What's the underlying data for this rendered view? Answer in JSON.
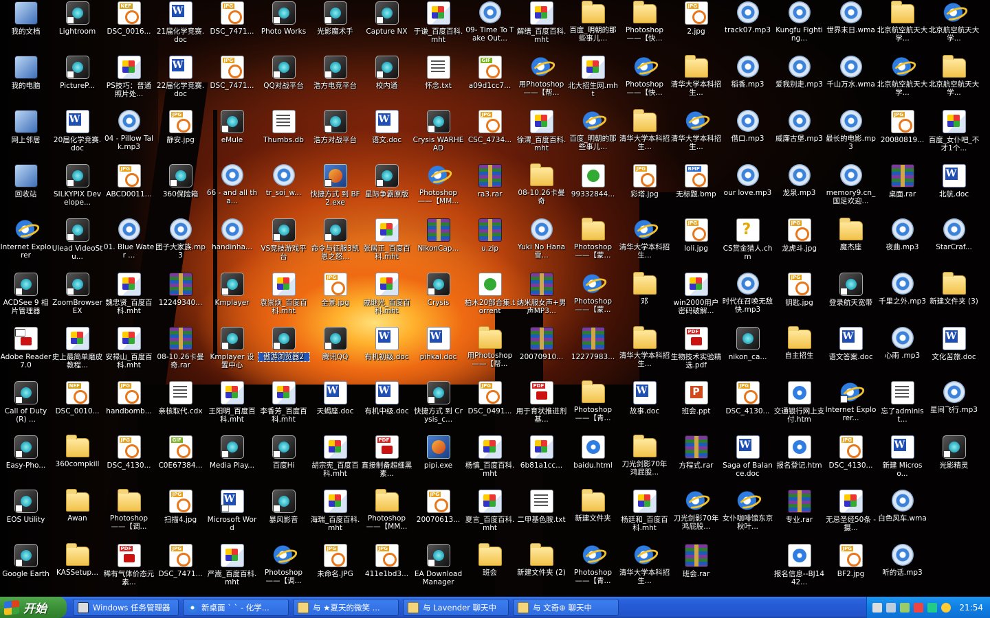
{
  "desktop": {
    "columns": [
      [
        {
          "label": "我的文档",
          "kind": "k-sys"
        },
        {
          "label": "我的电脑",
          "kind": "k-sys"
        },
        {
          "label": "网上邻居",
          "kind": "k-sys"
        },
        {
          "label": "回收站",
          "kind": "k-sys"
        },
        {
          "label": "Internet Explorer",
          "kind": "k-ie"
        },
        {
          "label": "ACDSee 9 相片管理器",
          "kind": "k-app",
          "shortcut": true
        },
        {
          "label": "Adobe Reader 7.0",
          "kind": "k-pdf",
          "shortcut": true
        },
        {
          "label": "Call of Duty(R) ...",
          "kind": "k-app",
          "shortcut": true
        },
        {
          "label": "Easy-Pho...",
          "kind": "k-app",
          "shortcut": true
        },
        {
          "label": "EOS Utility",
          "kind": "k-app",
          "shortcut": true
        },
        {
          "label": "Google Earth",
          "kind": "k-app",
          "shortcut": true
        }
      ],
      [
        {
          "label": "Lightroom",
          "kind": "k-app",
          "shortcut": true
        },
        {
          "label": "PictureP...",
          "kind": "k-app",
          "shortcut": true
        },
        {
          "label": "20届化学竞赛.doc",
          "kind": "k-doc"
        },
        {
          "label": "SILKYPIX Develope...",
          "kind": "k-app",
          "shortcut": true
        },
        {
          "label": "Ulead VideoStu...",
          "kind": "k-app",
          "shortcut": true
        },
        {
          "label": "ZoomBrowser EX",
          "kind": "k-app",
          "shortcut": true
        },
        {
          "label": "史上最简单磨皮教程...",
          "kind": "k-mht"
        },
        {
          "label": "DSC_0010...",
          "kind": "k-nef"
        },
        {
          "label": "360compkill",
          "kind": "k-folder"
        },
        {
          "label": "Awan",
          "kind": "k-folder"
        },
        {
          "label": "KASSetup...",
          "kind": "k-folder"
        }
      ],
      [
        {
          "label": "DSC_0016...",
          "kind": "k-nef"
        },
        {
          "label": "PS技巧：普通照片处...",
          "kind": "k-mht"
        },
        {
          "label": "04 - Pillow Talk.mp3",
          "kind": "k-mp3"
        },
        {
          "label": "ABCD0011...",
          "kind": "k-jpg"
        },
        {
          "label": "01. Blue Water ...",
          "kind": "k-mp3"
        },
        {
          "label": "魏忠贤_百度百科.mht",
          "kind": "k-mht"
        },
        {
          "label": "安禄山_百度百科.mht",
          "kind": "k-mht"
        },
        {
          "label": "handbomb...",
          "kind": "k-jpg"
        },
        {
          "label": "DSC_4130...",
          "kind": "k-jpg"
        },
        {
          "label": "Photoshop——【调...",
          "kind": "k-folder"
        },
        {
          "label": "稀有气体价态元素...",
          "kind": "k-pdf"
        }
      ],
      [
        {
          "label": "21届化学竞赛.doc",
          "kind": "k-doc"
        },
        {
          "label": "22届化学竞赛.doc",
          "kind": "k-doc"
        },
        {
          "label": "静安.jpg",
          "kind": "k-jpg"
        },
        {
          "label": "360保险箱",
          "kind": "k-app",
          "shortcut": true
        },
        {
          "label": "团子大家族.mp3",
          "kind": "k-mp3"
        },
        {
          "label": "12249340...",
          "kind": "k-rar"
        },
        {
          "label": "08-10.26卡曼奇.rar",
          "kind": "k-rar"
        },
        {
          "label": "亲核取代.cdx",
          "kind": "k-txt"
        },
        {
          "label": "C0E67384...",
          "kind": "k-gif"
        },
        {
          "label": "扫描4.jpg",
          "kind": "k-jpg"
        },
        {
          "label": "DSC_7471...",
          "kind": "k-jpg"
        }
      ],
      [
        {
          "label": "DSC_7471...",
          "kind": "k-jpg"
        },
        {
          "label": "DSC_7471...",
          "kind": "k-jpg"
        },
        {
          "label": "eMule",
          "kind": "k-app",
          "shortcut": true
        },
        {
          "label": "66 - and all tha...",
          "kind": "k-mp3"
        },
        {
          "label": "handinha...",
          "kind": "k-mp3"
        },
        {
          "label": "Kmplayer",
          "kind": "k-app",
          "shortcut": true
        },
        {
          "label": "Kmplayer 设置中心",
          "kind": "k-app",
          "shortcut": true
        },
        {
          "label": "王阳明_百度百科.mht",
          "kind": "k-mht"
        },
        {
          "label": "Media Play...",
          "kind": "k-app",
          "shortcut": true
        },
        {
          "label": "Microsoft Word",
          "kind": "k-doc",
          "shortcut": true
        },
        {
          "label": "严嵩_百度百科.mht",
          "kind": "k-mht"
        }
      ],
      [
        {
          "label": "Photo Works",
          "kind": "k-app",
          "shortcut": true
        },
        {
          "label": "QQ对战平台",
          "kind": "k-app",
          "shortcut": true
        },
        {
          "label": "Thumbs.db",
          "kind": "k-txt"
        },
        {
          "label": "tr_soi_w...",
          "kind": "k-mp3"
        },
        {
          "label": "VS竞技游戏平台",
          "kind": "k-app",
          "shortcut": true
        },
        {
          "label": "袁崇焕_百度百科.mht",
          "kind": "k-mht"
        },
        {
          "label": "傲游浏览器2",
          "kind": "k-app",
          "shortcut": true,
          "selected": true
        },
        {
          "label": "李香芳_百度百科.mht",
          "kind": "k-mht"
        },
        {
          "label": "百度Hi",
          "kind": "k-app",
          "shortcut": true
        },
        {
          "label": "暴风影音",
          "kind": "k-app",
          "shortcut": true
        },
        {
          "label": "Photoshop——【调...",
          "kind": "k-ie"
        }
      ],
      [
        {
          "label": "光影魔术手",
          "kind": "k-app",
          "shortcut": true
        },
        {
          "label": "浩方电竞平台",
          "kind": "k-app",
          "shortcut": true
        },
        {
          "label": "浩方对战平台",
          "kind": "k-app",
          "shortcut": true
        },
        {
          "label": "快捷方式 到 BF2.exe",
          "kind": "k-exe",
          "shortcut": true
        },
        {
          "label": "命令与征服3凯恩之怒...",
          "kind": "k-app",
          "shortcut": true
        },
        {
          "label": "全景.jpg",
          "kind": "k-jpg"
        },
        {
          "label": "腾讯QQ",
          "kind": "k-app",
          "shortcut": true
        },
        {
          "label": "天蝎座.doc",
          "kind": "k-doc"
        },
        {
          "label": "胡宗宪_百度百科.mht",
          "kind": "k-mht"
        },
        {
          "label": "海瑞_百度百科.mht",
          "kind": "k-mht"
        },
        {
          "label": "未命名.JPG",
          "kind": "k-jpg"
        }
      ],
      [
        {
          "label": "Capture NX",
          "kind": "k-app",
          "shortcut": true
        },
        {
          "label": "校内通",
          "kind": "k-app",
          "shortcut": true
        },
        {
          "label": "语文.doc",
          "kind": "k-doc"
        },
        {
          "label": "星际争霸原版",
          "kind": "k-app",
          "shortcut": true
        },
        {
          "label": "张居正_百度百科.mht",
          "kind": "k-mht"
        },
        {
          "label": "戚继光_百度百科.mht",
          "kind": "k-mht"
        },
        {
          "label": "有机初级.doc",
          "kind": "k-doc"
        },
        {
          "label": "有机中级.doc",
          "kind": "k-doc"
        },
        {
          "label": "直接制备超细黑素...",
          "kind": "k-pdf"
        },
        {
          "label": "Photoshop——【MM...",
          "kind": "k-folder"
        },
        {
          "label": "411e1bd3...",
          "kind": "k-jpg"
        }
      ],
      [
        {
          "label": "于谦_百度百科.mht",
          "kind": "k-mht"
        },
        {
          "label": "怀念.txt",
          "kind": "k-txt"
        },
        {
          "label": "Crysis WARHEAD",
          "kind": "k-app",
          "shortcut": true
        },
        {
          "label": "Photoshop——【MM...",
          "kind": "k-ie"
        },
        {
          "label": "NikonCap...",
          "kind": "k-rar"
        },
        {
          "label": "Crysis",
          "kind": "k-app",
          "shortcut": true
        },
        {
          "label": "pihkal.doc",
          "kind": "k-doc"
        },
        {
          "label": "快捷方式 到 Crysis_c...",
          "kind": "k-app",
          "shortcut": true
        },
        {
          "label": "pipi.exe",
          "kind": "k-exe"
        },
        {
          "label": "20070613...",
          "kind": "k-jpg"
        },
        {
          "label": "EA Download Manager",
          "kind": "k-app",
          "shortcut": true
        }
      ],
      [
        {
          "label": "09- Time To Take Out...",
          "kind": "k-mp3"
        },
        {
          "label": "a09d1cc7...",
          "kind": "k-gif"
        },
        {
          "label": "CSC_4734...",
          "kind": "k-jpg"
        },
        {
          "label": "ra3.rar",
          "kind": "k-rar"
        },
        {
          "label": "u.zip",
          "kind": "k-rar"
        },
        {
          "label": "柏木20部合集.torrent",
          "kind": "k-torrent"
        },
        {
          "label": "用Photoshop——【帮...",
          "kind": "k-folder"
        },
        {
          "label": "DSC_0491...",
          "kind": "k-jpg"
        },
        {
          "label": "杨慎_百度百科.mht",
          "kind": "k-mht"
        },
        {
          "label": "夏言_百度百科.mht",
          "kind": "k-mht"
        },
        {
          "label": "班会",
          "kind": "k-folder"
        }
      ],
      [
        {
          "label": "解缙_百度百科.mht",
          "kind": "k-mht"
        },
        {
          "label": "用Photoshop——【帮...",
          "kind": "k-ie"
        },
        {
          "label": "徐渭_百度百科.mht",
          "kind": "k-mht"
        },
        {
          "label": "08-10.26卡曼奇",
          "kind": "k-folder"
        },
        {
          "label": "Yuki No Hana 雪...",
          "kind": "k-mp3"
        },
        {
          "label": "纳米服女声+男声MP3...",
          "kind": "k-rar"
        },
        {
          "label": "20070910...",
          "kind": "k-rar"
        },
        {
          "label": "用于育状推进剂基...",
          "kind": "k-pdf"
        },
        {
          "label": "6b81a1cc...",
          "kind": "k-mht"
        },
        {
          "label": "二甲基色胺.txt",
          "kind": "k-txt"
        },
        {
          "label": "新建文件夹 (2)",
          "kind": "k-folder"
        }
      ],
      [
        {
          "label": "百度_明朝的那些事儿...",
          "kind": "k-folder"
        },
        {
          "label": "北大招生网.mht",
          "kind": "k-mht"
        },
        {
          "label": "百度_明朝的那些事儿...",
          "kind": "k-ie"
        },
        {
          "label": "99332844...",
          "kind": "k-torrent"
        },
        {
          "label": "Photoshop——【蒙...",
          "kind": "k-folder"
        },
        {
          "label": "Photoshop——【蒙...",
          "kind": "k-ie"
        },
        {
          "label": "12277983...",
          "kind": "k-rar"
        },
        {
          "label": "Photoshop——【青...",
          "kind": "k-folder"
        },
        {
          "label": "baidu.html",
          "kind": "k-htm"
        },
        {
          "label": "新建文件夹",
          "kind": "k-folder"
        },
        {
          "label": "Photoshop——【青...",
          "kind": "k-ie"
        }
      ],
      [
        {
          "label": "Photoshop——【快...",
          "kind": "k-folder"
        },
        {
          "label": "Photoshop——【快...",
          "kind": "k-ie"
        },
        {
          "label": "清华大学本科招生...",
          "kind": "k-folder"
        },
        {
          "label": "彩塔.jpg",
          "kind": "k-jpg"
        },
        {
          "label": "清华大学本科招生...",
          "kind": "k-ie"
        },
        {
          "label": "邓",
          "kind": "k-folder"
        },
        {
          "label": "清华大学本科招生...",
          "kind": "k-folder"
        },
        {
          "label": "故事.doc",
          "kind": "k-doc"
        },
        {
          "label": "刀光剑影70年鸿屁股...",
          "kind": "k-folder"
        },
        {
          "label": "杨廷和_百度百科.mht",
          "kind": "k-mht"
        },
        {
          "label": "清华大学本科招生...",
          "kind": "k-ie"
        }
      ],
      [
        {
          "label": "2.jpg",
          "kind": "k-jpg"
        },
        {
          "label": "清华大学本科招生...",
          "kind": "k-folder"
        },
        {
          "label": "清华大学本科招生...",
          "kind": "k-ie"
        },
        {
          "label": "无标题.bmp",
          "kind": "k-bmp"
        },
        {
          "label": "loli.jpg",
          "kind": "k-jpg"
        },
        {
          "label": "win2000用户密码破解...",
          "kind": "k-mht"
        },
        {
          "label": "生物技术实验精选.pdf",
          "kind": "k-pdf"
        },
        {
          "label": "班会.ppt",
          "kind": "k-ppt"
        },
        {
          "label": "方程式.rar",
          "kind": "k-rar"
        },
        {
          "label": "刀光剑影70年鸿屁股...",
          "kind": "k-ie"
        },
        {
          "label": "班会.rar",
          "kind": "k-rar"
        }
      ],
      [
        {
          "label": "track07.mp3",
          "kind": "k-mp3"
        },
        {
          "label": "稻香.mp3",
          "kind": "k-mp3"
        },
        {
          "label": "借口.mp3",
          "kind": "k-mp3"
        },
        {
          "label": "our love.mp3",
          "kind": "k-mp3"
        },
        {
          "label": "CS赏金猎人.chm",
          "kind": "k-chm"
        },
        {
          "label": "时代在召唤无敌快.mp3",
          "kind": "k-mp3"
        },
        {
          "label": "nikon_ca...",
          "kind": "k-app"
        },
        {
          "label": "DSC_4130...",
          "kind": "k-jpg"
        },
        {
          "label": "Saga of Balance.doc",
          "kind": "k-doc"
        },
        {
          "label": "女仆咖啡馆东京秋叶...",
          "kind": "k-ie"
        }
      ],
      [
        {
          "label": "Kungfu Fighting...",
          "kind": "k-mp3"
        },
        {
          "label": "爱我别走.mp3",
          "kind": "k-mp3"
        },
        {
          "label": "威廉古堡.mp3",
          "kind": "k-mp3"
        },
        {
          "label": "龙泉.mp3",
          "kind": "k-mp3"
        },
        {
          "label": "龙虎斗.jpg",
          "kind": "k-jpg"
        },
        {
          "label": "钥匙.jpg",
          "kind": "k-jpg"
        },
        {
          "label": "自主招生",
          "kind": "k-folder"
        },
        {
          "label": "交通银行网上支付.htm",
          "kind": "k-htm"
        },
        {
          "label": "报名登记.htm",
          "kind": "k-htm"
        },
        {
          "label": "专业.rar",
          "kind": "k-rar"
        },
        {
          "label": "报名信息--BJ1442...",
          "kind": "k-htm"
        }
      ],
      [
        {
          "label": "世界末日.wma",
          "kind": "k-mp3"
        },
        {
          "label": "千山万水.wma",
          "kind": "k-mp3"
        },
        {
          "label": "最长的电影.mp3",
          "kind": "k-mp3"
        },
        {
          "label": "memory9.cn_国足欢迎...",
          "kind": "k-mp3"
        },
        {
          "label": "魔杰座",
          "kind": "k-folder"
        },
        {
          "label": "登录航天宽带",
          "kind": "k-app",
          "shortcut": true
        },
        {
          "label": "语文答案.doc",
          "kind": "k-doc"
        },
        {
          "label": "Internet Explorer...",
          "kind": "k-ie",
          "shortcut": true
        },
        {
          "label": "DSC_4130...",
          "kind": "k-jpg"
        },
        {
          "label": "无忌圣经50条 - 摄...",
          "kind": "k-mht"
        },
        {
          "label": "BF2.jpg",
          "kind": "k-jpg"
        }
      ],
      [
        {
          "label": "北京航空航天大学...",
          "kind": "k-folder"
        },
        {
          "label": "北京航空航天大学...",
          "kind": "k-ie"
        },
        {
          "label": "20080819...",
          "kind": "k-jpg"
        },
        {
          "label": "桌面.rar",
          "kind": "k-rar"
        },
        {
          "label": "夜曲.mp3",
          "kind": "k-mp3"
        },
        {
          "label": "千里之外.mp3",
          "kind": "k-mp3"
        },
        {
          "label": "心雨 .mp3",
          "kind": "k-mp3"
        },
        {
          "label": "忘了administ...",
          "kind": "k-txt"
        },
        {
          "label": "新建 Microso...",
          "kind": "k-doc"
        },
        {
          "label": "白色风车.wma",
          "kind": "k-mp3"
        },
        {
          "label": "听的话.mp3",
          "kind": "k-mp3"
        }
      ],
      [
        {
          "label": "北京航空航天大学...",
          "kind": "k-ie"
        },
        {
          "label": "北京航空航天大学...",
          "kind": "k-folder"
        },
        {
          "label": "百度_女仆吧_不才1个...",
          "kind": "k-mht"
        },
        {
          "label": "北航.doc",
          "kind": "k-doc"
        },
        {
          "label": "StarCraf...",
          "kind": "k-mp3"
        },
        {
          "label": "新建文件夹 (3)",
          "kind": "k-folder"
        },
        {
          "label": "文化苦旅.doc",
          "kind": "k-doc"
        },
        {
          "label": "星间飞行.mp3",
          "kind": "k-mp3"
        },
        {
          "label": "光影精灵",
          "kind": "k-app",
          "shortcut": true
        }
      ]
    ]
  },
  "taskbar": {
    "start_label": "开始",
    "tasks": [
      {
        "label": "Windows 任务管理器",
        "icon": "ti-monitor",
        "active": false
      },
      {
        "label": "新桌面 ` ` - 化学...",
        "icon": "ti-ie",
        "active": false
      },
      {
        "label": "与 ★夏天的微笑 ...",
        "icon": "ti-chat",
        "active": false
      },
      {
        "label": "与 Lavender 聊天中",
        "icon": "ti-chat",
        "active": false
      },
      {
        "label": "与 文奇⊕ 聊天中",
        "icon": "ti-chat",
        "active": false
      }
    ],
    "clock": "21:54"
  }
}
